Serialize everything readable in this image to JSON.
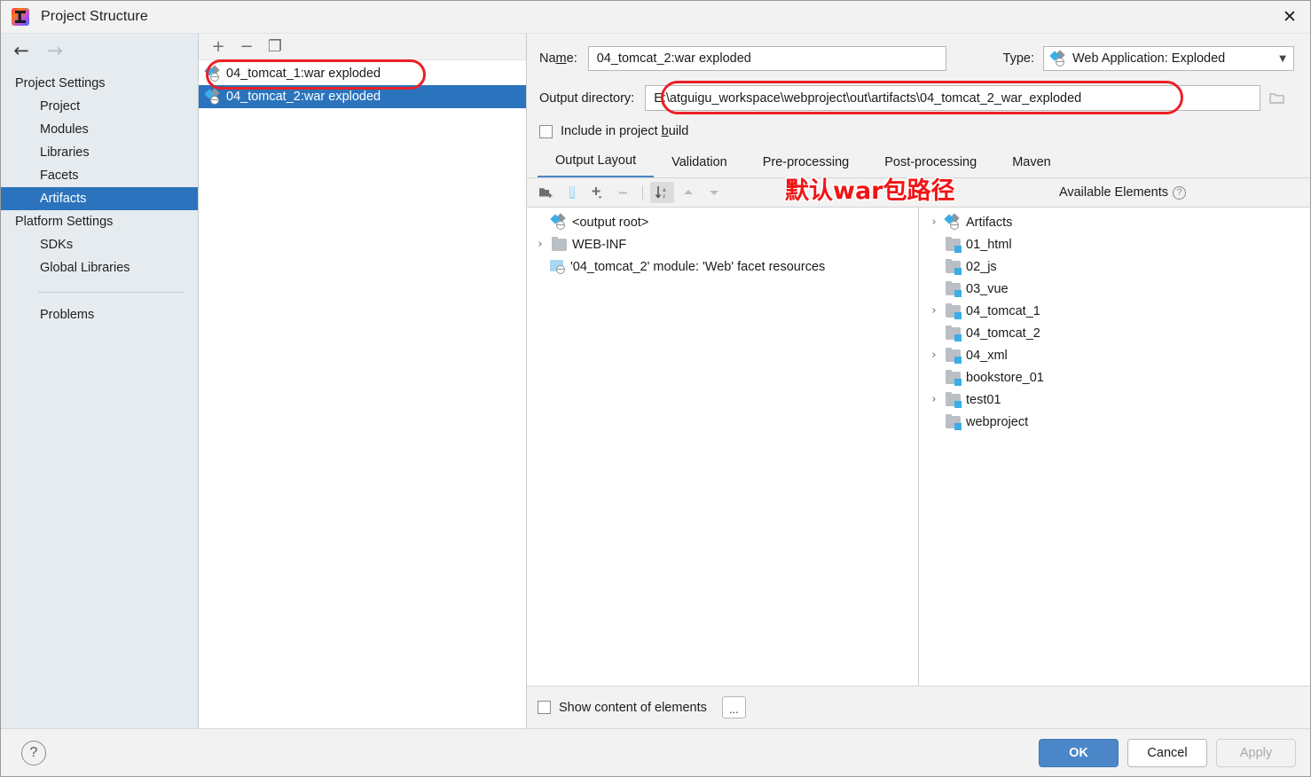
{
  "window": {
    "title": "Project Structure",
    "app_icon": "intellij-idea-logo",
    "close_icon": "✕"
  },
  "nav": {
    "back_icon": "←",
    "forward_icon": "→"
  },
  "sidebar": {
    "groups": [
      {
        "label": "Project Settings",
        "header": true,
        "items": [
          {
            "label": "Project",
            "selected": false
          },
          {
            "label": "Modules",
            "selected": false
          },
          {
            "label": "Libraries",
            "selected": false
          },
          {
            "label": "Facets",
            "selected": false
          },
          {
            "label": "Artifacts",
            "selected": true
          }
        ]
      },
      {
        "label": "Platform Settings",
        "header": true,
        "items": [
          {
            "label": "SDKs",
            "selected": false
          },
          {
            "label": "Global Libraries",
            "selected": false
          }
        ]
      }
    ],
    "problems_label": "Problems"
  },
  "artifacts": {
    "toolbar": [
      {
        "name": "add-artifact-button",
        "glyph": "+"
      },
      {
        "name": "remove-artifact-button",
        "glyph": "−"
      },
      {
        "name": "copy-artifact-button",
        "glyph": "❐"
      }
    ],
    "items": [
      {
        "label": "04_tomcat_1:war exploded",
        "selected": false
      },
      {
        "label": "04_tomcat_2:war exploded",
        "selected": true
      }
    ]
  },
  "detail": {
    "name_label": "Name:",
    "name_value": "04_tomcat_2:war exploded",
    "type_label": "Type:",
    "type_value": "Web Application: Exploded",
    "type_chevron": "▼",
    "outdir_label": "Output directory:",
    "outdir_value": "E:\\atguigu_workspace\\webproject\\out\\artifacts\\04_tomcat_2_war_exploded",
    "include_build_label": "Include in project build",
    "include_build_checked": false,
    "tabs": [
      {
        "label": "Output Layout",
        "active": true
      },
      {
        "label": "Validation",
        "active": false
      },
      {
        "label": "Pre-processing",
        "active": false
      },
      {
        "label": "Post-processing",
        "active": false
      },
      {
        "label": "Maven",
        "active": false
      }
    ],
    "layout_toolbar": [
      {
        "name": "create-directory-button",
        "enabled": true
      },
      {
        "name": "create-archive-button",
        "enabled": true
      },
      {
        "name": "add-element-button",
        "enabled": true
      },
      {
        "name": "remove-element-button",
        "enabled": false
      },
      {
        "name": "sort-alphabetically-button",
        "enabled": true,
        "active": true
      },
      {
        "name": "move-up-button",
        "enabled": false
      },
      {
        "name": "move-down-button",
        "enabled": false
      }
    ],
    "available_elements_label": "Available Elements",
    "help_glyph": "?",
    "show_content_label": "Show content of elements",
    "show_content_checked": false,
    "ellipsis_button_label": "..."
  },
  "output_layout_tree": [
    {
      "label": "<output root>",
      "icon": "artifact-icon",
      "indent": 0,
      "expander": "none"
    },
    {
      "label": "WEB-INF",
      "icon": "folder-icon",
      "indent": 0,
      "expander": "collapsed"
    },
    {
      "label": "'04_tomcat_2' module: 'Web' facet resources",
      "icon": "web-facet-icon",
      "indent": 1,
      "expander": "none"
    }
  ],
  "available_elements_tree": [
    {
      "label": "Artifacts",
      "icon": "artifact-icon",
      "expander": "collapsed"
    },
    {
      "label": "01_html",
      "icon": "module-folder-icon",
      "expander": "none"
    },
    {
      "label": "02_js",
      "icon": "module-folder-icon",
      "expander": "none"
    },
    {
      "label": "03_vue",
      "icon": "module-folder-icon",
      "expander": "none"
    },
    {
      "label": "04_tomcat_1",
      "icon": "module-folder-icon",
      "expander": "collapsed"
    },
    {
      "label": "04_tomcat_2",
      "icon": "module-folder-icon",
      "expander": "none"
    },
    {
      "label": "04_xml",
      "icon": "module-folder-icon",
      "expander": "collapsed"
    },
    {
      "label": "bookstore_01",
      "icon": "module-folder-icon",
      "expander": "none"
    },
    {
      "label": "test01",
      "icon": "module-folder-icon",
      "expander": "collapsed"
    },
    {
      "label": "webproject",
      "icon": "module-folder-icon",
      "expander": "none"
    }
  ],
  "annotations": {
    "note_text": "默认war包路径",
    "color": "#f01515"
  },
  "footer": {
    "help_glyph": "?",
    "ok_label": "OK",
    "cancel_label": "Cancel",
    "apply_label": "Apply",
    "apply_enabled": false
  },
  "colors": {
    "selection_blue": "#2b74bd",
    "primary_button": "#4a86c8",
    "sidebar_bg": "#e6ebef",
    "panel_bg": "#f2f2f2",
    "annotation_red": "#f01515"
  }
}
